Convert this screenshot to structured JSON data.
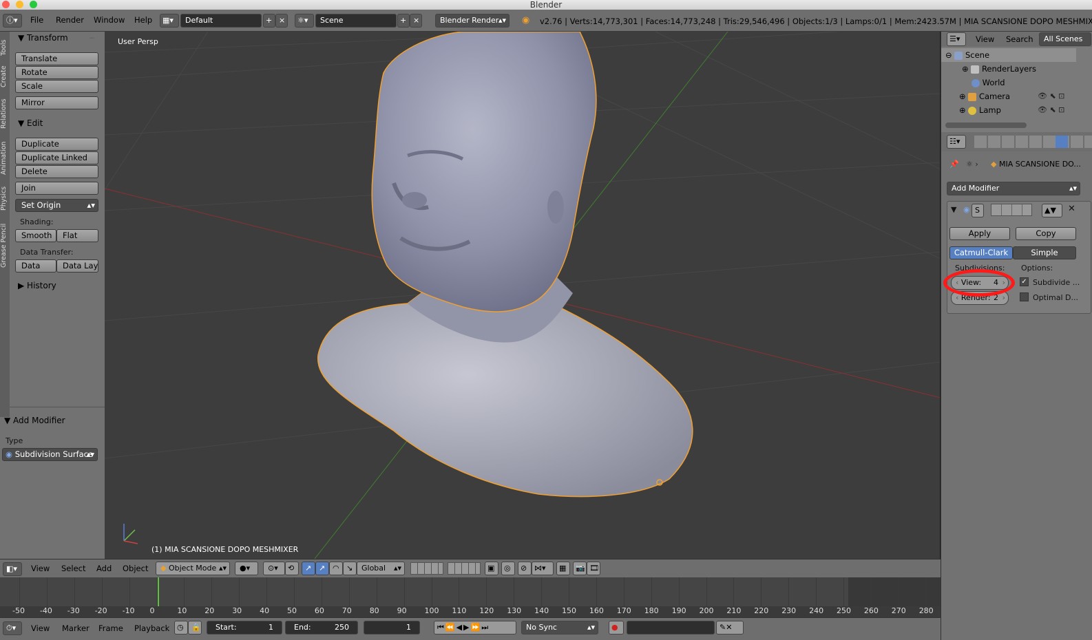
{
  "window": {
    "title": "Blender"
  },
  "topbar": {
    "menus": [
      "File",
      "Render",
      "Window",
      "Help"
    ],
    "layout": "Default",
    "scene": "Scene",
    "engine": "Blender Render",
    "stats": "v2.76 | Verts:14,773,301 | Faces:14,773,248 | Tris:29,546,496 | Objects:1/3 | Lamps:0/1 | Mem:2423.57M | MIA SCANSIONE DOPO MESHMIXER"
  },
  "toolshelf": {
    "tabs": [
      "Tools",
      "Create",
      "Relations",
      "Animation",
      "Physics",
      "Grease Pencil"
    ],
    "transform": {
      "title": "Transform",
      "translate": "Translate",
      "rotate": "Rotate",
      "scale": "Scale",
      "mirror": "Mirror"
    },
    "edit": {
      "title": "Edit",
      "duplicate": "Duplicate",
      "duplicate_linked": "Duplicate Linked",
      "delete": "Delete",
      "join": "Join",
      "set_origin": "Set Origin",
      "shading_label": "Shading:",
      "smooth": "Smooth",
      "flat": "Flat",
      "data_transfer_label": "Data Transfer:",
      "data": "Data",
      "data_layout": "Data Layo"
    },
    "history": "History",
    "operator": {
      "title": "Add Modifier",
      "type_label": "Type",
      "type_value": "Subdivision Surface"
    }
  },
  "viewport": {
    "view_name": "User Persp",
    "object_label": "(1) MIA SCANSIONE DOPO MESHMIXER"
  },
  "viewport_header": {
    "menus": [
      "View",
      "Select",
      "Add",
      "Object"
    ],
    "mode": "Object Mode",
    "orientation": "Global"
  },
  "timeline": {
    "ticks": [
      "-50",
      "-40",
      "-30",
      "-20",
      "-10",
      "0",
      "10",
      "20",
      "30",
      "40",
      "50",
      "60",
      "70",
      "80",
      "90",
      "100",
      "110",
      "120",
      "130",
      "140",
      "150",
      "160",
      "170",
      "180",
      "190",
      "200",
      "210",
      "220",
      "230",
      "240",
      "250",
      "260",
      "270",
      "280"
    ]
  },
  "timeline_header": {
    "menus": [
      "View",
      "Marker",
      "Frame",
      "Playback"
    ],
    "start_label": "Start:",
    "start": "1",
    "end_label": "End:",
    "end": "250",
    "current": "1",
    "sync": "No Sync"
  },
  "outliner": {
    "tabs": [
      "View",
      "Search",
      "All Scenes"
    ],
    "items": [
      "Scene",
      "RenderLayers",
      "World",
      "Camera",
      "Lamp"
    ]
  },
  "properties": {
    "object_name": "MIA SCANSIONE DO...",
    "add_modifier": "Add Modifier",
    "mod_short": "S",
    "apply": "Apply",
    "copy": "Copy",
    "catmull": "Catmull-Clark",
    "simple": "Simple",
    "subdivisions_label": "Subdivisions:",
    "options_label": "Options:",
    "view_label": "View:",
    "view_value": "4",
    "render_label": "Render:",
    "render_value": "2",
    "subdivide_uvs": "Subdivide ...",
    "optimal": "Optimal D..."
  },
  "colors": {
    "accent": "#5680c2",
    "selection": "#f0a030",
    "annotation": "#ff1a1a"
  }
}
